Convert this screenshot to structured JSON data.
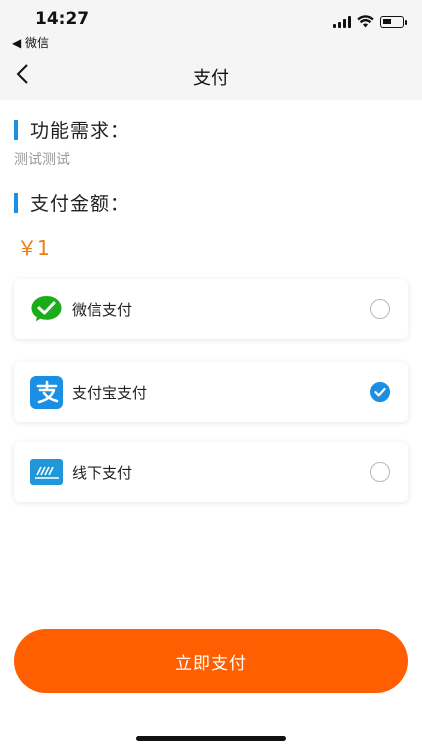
{
  "status_bar": {
    "time": "14:27",
    "back_app": "◀ 微信",
    "icons": [
      "signal-icon",
      "wifi-icon",
      "battery-icon"
    ]
  },
  "nav": {
    "title": "支付",
    "back_icon": "chevron-left-icon"
  },
  "requirement": {
    "heading": "功能需求：",
    "text": "测试测试"
  },
  "amount": {
    "heading": "支付金额：",
    "value": "￥1"
  },
  "payment_methods": [
    {
      "label": "微信支付",
      "icon": "wechat-pay-icon",
      "selected": false
    },
    {
      "label": "支付宝支付",
      "icon": "alipay-icon",
      "selected": true
    },
    {
      "label": "线下支付",
      "icon": "offline-pay-icon",
      "selected": false
    }
  ],
  "submit": {
    "label": "立即支付"
  },
  "colors": {
    "accent_blue": "#1a8fe3",
    "amount_orange": "#f07c12",
    "button_orange": "#ff5f00",
    "wechat_green": "#1aad19"
  }
}
